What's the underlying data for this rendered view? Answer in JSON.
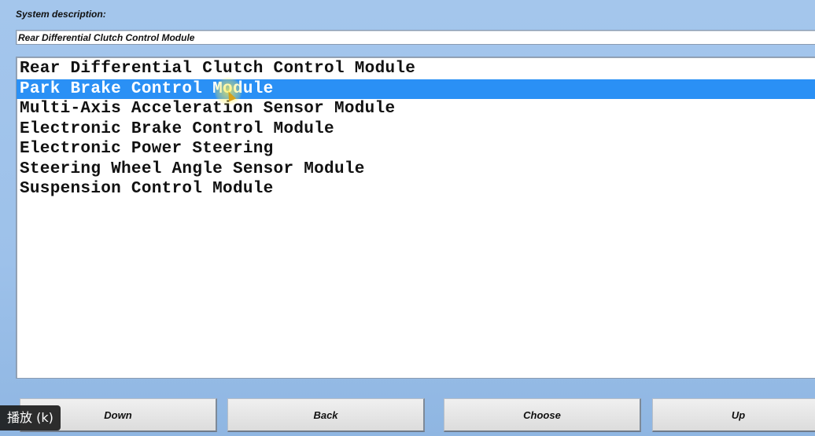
{
  "system_description": {
    "label": "System description:",
    "value": "Rear Differential Clutch Control Module"
  },
  "modules": [
    {
      "label": "Rear Differential Clutch Control Module",
      "selected": false
    },
    {
      "label": "Park Brake Control Module",
      "selected": true
    },
    {
      "label": "Multi-Axis Acceleration Sensor Module",
      "selected": false
    },
    {
      "label": "Electronic Brake Control Module",
      "selected": false
    },
    {
      "label": "Electronic Power Steering",
      "selected": false
    },
    {
      "label": "Steering Wheel Angle Sensor Module",
      "selected": false
    },
    {
      "label": "Suspension Control Module",
      "selected": false
    }
  ],
  "buttons": {
    "down": "Down",
    "back": "Back",
    "choose": "Choose",
    "up": "Up"
  },
  "tooltip": "播放 (k)",
  "colors": {
    "background": "#a4c6ec",
    "selection": "#2a90f5"
  }
}
